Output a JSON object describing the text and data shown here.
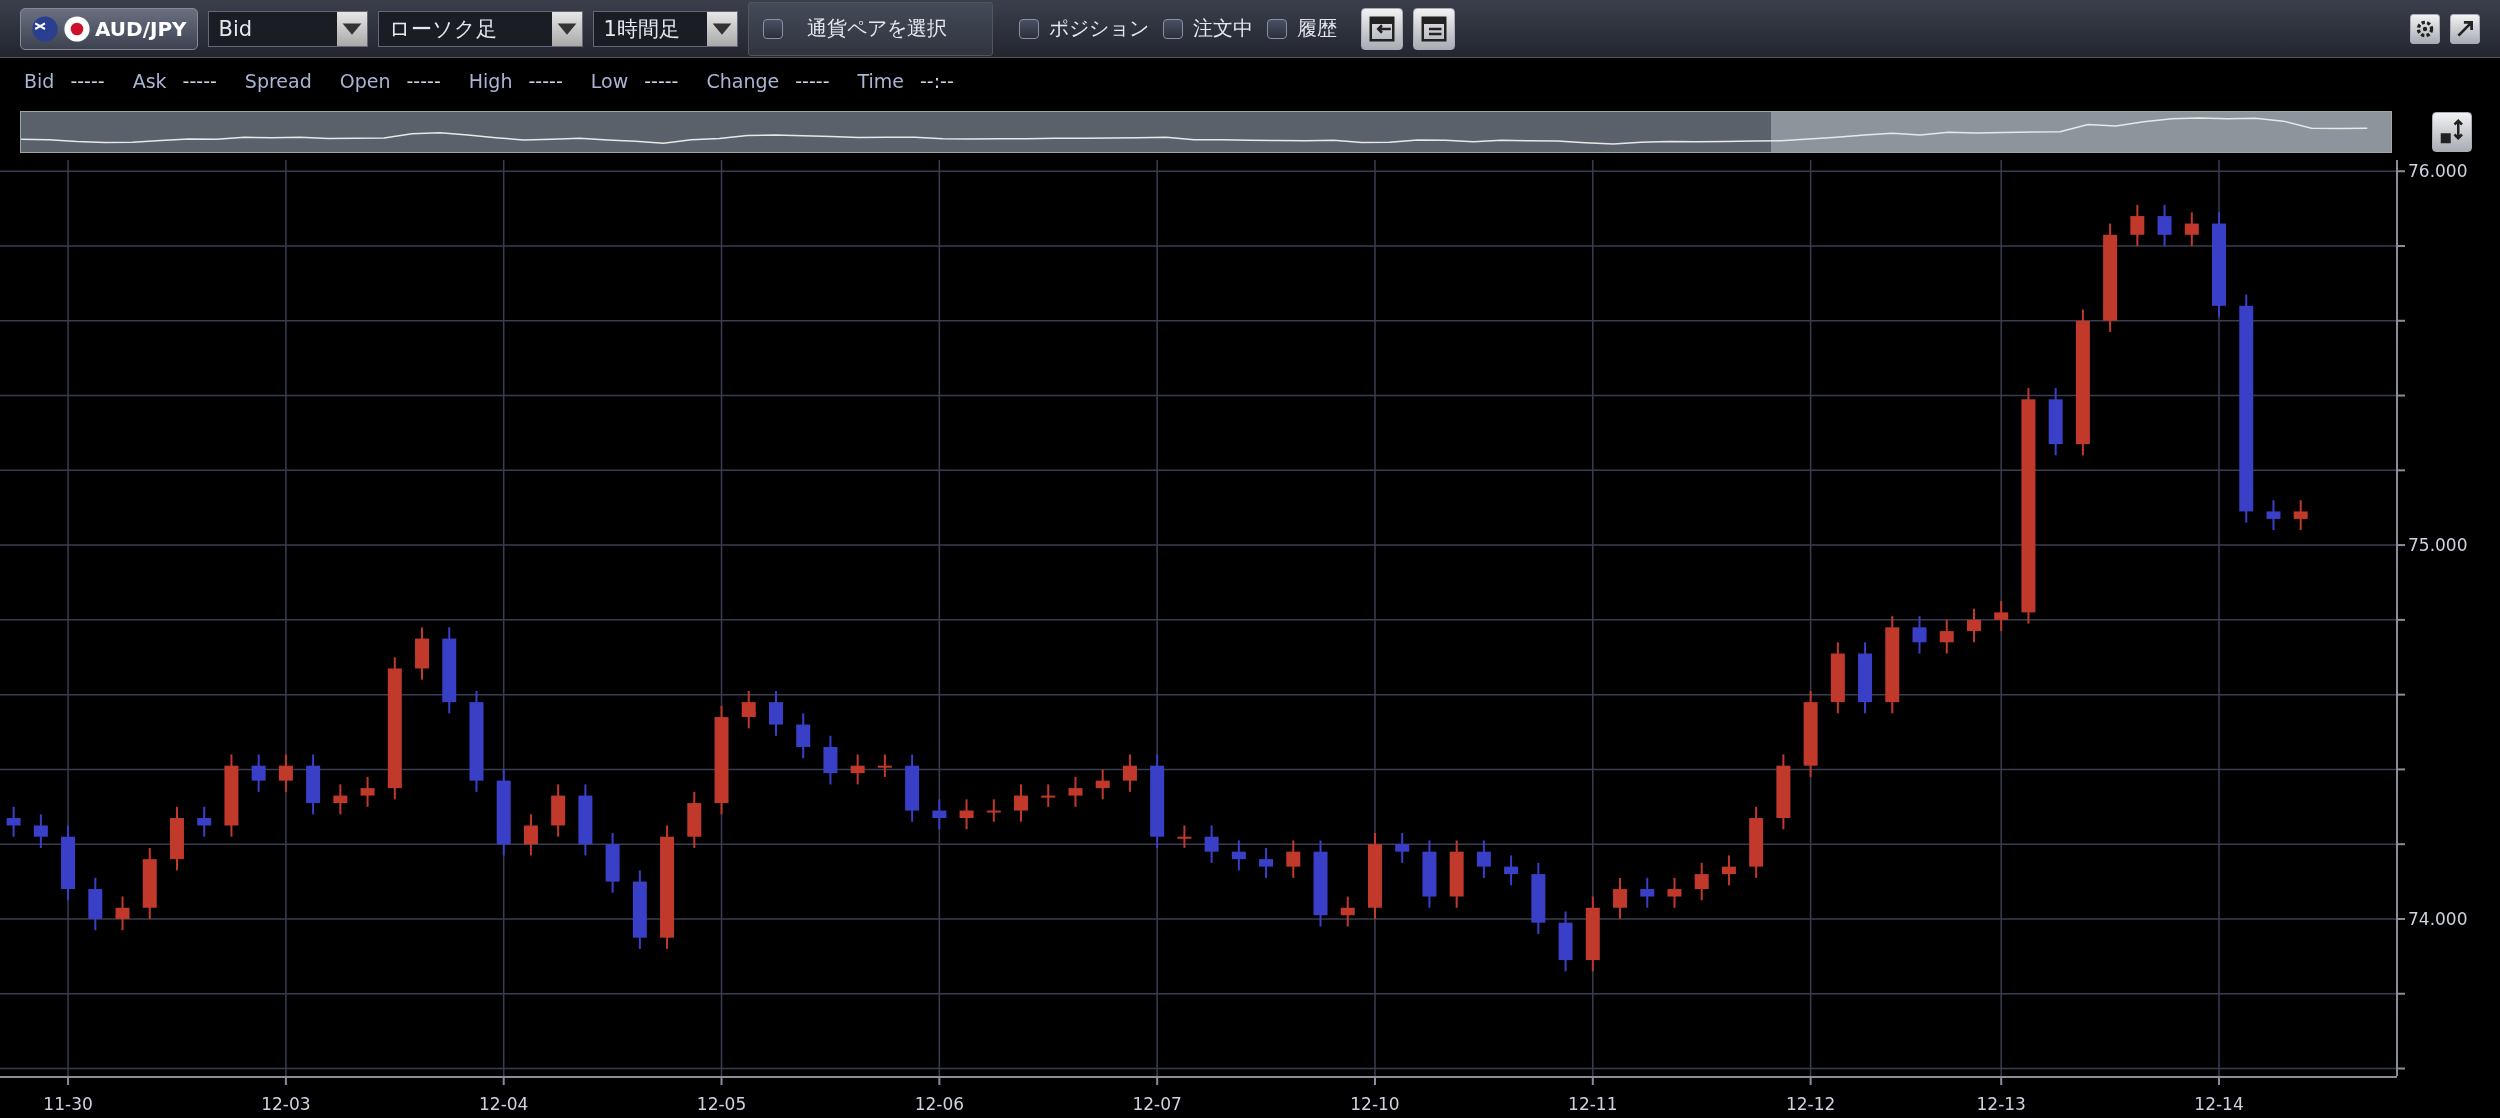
{
  "toolbar": {
    "pair": "AUD/JPY",
    "selects": [
      {
        "value": "Bid"
      },
      {
        "value": "ローソク足"
      },
      {
        "value": "1時間足"
      }
    ],
    "pair_picker": {
      "label": "通貨ペアを選択",
      "checked": false
    },
    "toggles": [
      {
        "label": "ポジション",
        "checked": false
      },
      {
        "label": "注文中",
        "checked": false
      },
      {
        "label": "履歴",
        "checked": false
      }
    ]
  },
  "info": [
    {
      "label": "Bid",
      "value": "-----"
    },
    {
      "label": "Ask",
      "value": "-----"
    },
    {
      "label": "Spread"
    },
    {
      "label": "Open",
      "value": "-----"
    },
    {
      "label": "High",
      "value": "-----"
    },
    {
      "label": "Low",
      "value": "-----"
    },
    {
      "label": "Change",
      "value": "-----"
    },
    {
      "label": "Time",
      "value": "--:--"
    }
  ],
  "chart_data": {
    "type": "candlestick",
    "grid": true,
    "ylim": [
      73.58,
      76.03
    ],
    "yticks": [
      {
        "value": 74,
        "label": "74.000"
      },
      {
        "value": 75,
        "label": "75.000"
      },
      {
        "value": 76,
        "label": "76.000"
      }
    ],
    "categories": [
      null,
      null,
      "11-30",
      null,
      null,
      null,
      null,
      null,
      null,
      null,
      "12-03",
      null,
      null,
      null,
      null,
      null,
      null,
      null,
      "12-04",
      null,
      null,
      null,
      null,
      null,
      null,
      null,
      "12-05",
      null,
      null,
      null,
      null,
      null,
      null,
      null,
      "12-06",
      null,
      null,
      null,
      null,
      null,
      null,
      null,
      "12-07",
      null,
      null,
      null,
      null,
      null,
      null,
      null,
      "12-10",
      null,
      null,
      null,
      null,
      null,
      null,
      null,
      "12-11",
      null,
      null,
      null,
      null,
      null,
      null,
      null,
      "12-12",
      null,
      null,
      null,
      null,
      null,
      null,
      "12-13",
      null,
      null,
      null,
      null,
      null,
      null,
      null,
      "12-14",
      null,
      null,
      null
    ],
    "ohlc": [
      [
        74.27,
        74.3,
        74.22,
        74.25
      ],
      [
        74.25,
        74.28,
        74.19,
        74.22
      ],
      [
        74.22,
        74.25,
        74.05,
        74.08
      ],
      [
        74.08,
        74.11,
        73.97,
        74.0
      ],
      [
        74.0,
        74.06,
        73.97,
        74.03
      ],
      [
        74.03,
        74.19,
        74.0,
        74.16
      ],
      [
        74.16,
        74.3,
        74.13,
        74.27
      ],
      [
        74.27,
        74.3,
        74.22,
        74.25
      ],
      [
        74.25,
        74.44,
        74.22,
        74.41
      ],
      [
        74.41,
        74.44,
        74.34,
        74.37
      ],
      [
        74.37,
        74.44,
        74.34,
        74.41
      ],
      [
        74.41,
        74.44,
        74.28,
        74.31
      ],
      [
        74.31,
        74.36,
        74.28,
        74.33
      ],
      [
        74.33,
        74.38,
        74.3,
        74.35
      ],
      [
        74.35,
        74.7,
        74.32,
        74.67
      ],
      [
        74.67,
        74.78,
        74.64,
        74.75
      ],
      [
        74.75,
        74.78,
        74.55,
        74.58
      ],
      [
        74.58,
        74.61,
        74.34,
        74.37
      ],
      [
        74.37,
        74.4,
        74.17,
        74.2
      ],
      [
        74.2,
        74.28,
        74.17,
        74.25
      ],
      [
        74.25,
        74.36,
        74.22,
        74.33
      ],
      [
        74.33,
        74.36,
        74.17,
        74.2
      ],
      [
        74.2,
        74.23,
        74.07,
        74.1
      ],
      [
        74.1,
        74.13,
        73.92,
        73.95
      ],
      [
        73.95,
        74.25,
        73.92,
        74.22
      ],
      [
        74.22,
        74.34,
        74.19,
        74.31
      ],
      [
        74.31,
        74.57,
        74.28,
        74.54
      ],
      [
        74.54,
        74.61,
        74.51,
        74.58
      ],
      [
        74.58,
        74.61,
        74.49,
        74.52
      ],
      [
        74.52,
        74.55,
        74.43,
        74.46
      ],
      [
        74.46,
        74.49,
        74.36,
        74.39
      ],
      [
        74.39,
        74.44,
        74.36,
        74.41
      ],
      [
        74.41,
        74.44,
        74.38,
        74.41
      ],
      [
        74.41,
        74.44,
        74.26,
        74.29
      ],
      [
        74.29,
        74.32,
        74.24,
        74.27
      ],
      [
        74.27,
        74.32,
        74.24,
        74.29
      ],
      [
        74.29,
        74.32,
        74.26,
        74.29
      ],
      [
        74.29,
        74.36,
        74.26,
        74.33
      ],
      [
        74.33,
        74.36,
        74.3,
        74.33
      ],
      [
        74.33,
        74.38,
        74.3,
        74.35
      ],
      [
        74.35,
        74.4,
        74.32,
        74.37
      ],
      [
        74.37,
        74.44,
        74.34,
        74.41
      ],
      [
        74.41,
        74.44,
        74.19,
        74.22
      ],
      [
        74.22,
        74.25,
        74.19,
        74.22
      ],
      [
        74.22,
        74.25,
        74.15,
        74.18
      ],
      [
        74.18,
        74.21,
        74.13,
        74.16
      ],
      [
        74.16,
        74.19,
        74.11,
        74.14
      ],
      [
        74.14,
        74.21,
        74.11,
        74.18
      ],
      [
        74.18,
        74.21,
        73.98,
        74.01
      ],
      [
        74.01,
        74.06,
        73.98,
        74.03
      ],
      [
        74.03,
        74.23,
        74.0,
        74.2
      ],
      [
        74.2,
        74.23,
        74.15,
        74.18
      ],
      [
        74.18,
        74.21,
        74.03,
        74.06
      ],
      [
        74.06,
        74.21,
        74.03,
        74.18
      ],
      [
        74.18,
        74.21,
        74.11,
        74.14
      ],
      [
        74.14,
        74.17,
        74.09,
        74.12
      ],
      [
        74.12,
        74.15,
        73.96,
        73.99
      ],
      [
        73.99,
        74.02,
        73.86,
        73.89
      ],
      [
        73.89,
        74.06,
        73.86,
        74.03
      ],
      [
        74.03,
        74.11,
        74.0,
        74.08
      ],
      [
        74.08,
        74.11,
        74.03,
        74.06
      ],
      [
        74.06,
        74.11,
        74.03,
        74.08
      ],
      [
        74.08,
        74.15,
        74.05,
        74.12
      ],
      [
        74.12,
        74.17,
        74.09,
        74.14
      ],
      [
        74.14,
        74.3,
        74.11,
        74.27
      ],
      [
        74.27,
        74.44,
        74.24,
        74.41
      ],
      [
        74.41,
        74.61,
        74.38,
        74.58
      ],
      [
        74.58,
        74.74,
        74.55,
        74.71
      ],
      [
        74.71,
        74.74,
        74.55,
        74.58
      ],
      [
        74.58,
        74.81,
        74.55,
        74.78
      ],
      [
        74.78,
        74.81,
        74.71,
        74.74
      ],
      [
        74.74,
        74.8,
        74.71,
        74.77
      ],
      [
        74.77,
        74.83,
        74.74,
        74.8
      ],
      [
        74.8,
        74.85,
        74.77,
        74.82
      ],
      [
        74.82,
        75.42,
        74.79,
        75.39
      ],
      [
        75.39,
        75.42,
        75.24,
        75.27
      ],
      [
        75.27,
        75.63,
        75.24,
        75.6
      ],
      [
        75.6,
        75.86,
        75.57,
        75.83
      ],
      [
        75.83,
        75.91,
        75.8,
        75.88
      ],
      [
        75.88,
        75.91,
        75.8,
        75.83
      ],
      [
        75.83,
        75.89,
        75.8,
        75.86
      ],
      [
        75.86,
        75.89,
        75.61,
        75.64
      ],
      [
        75.64,
        75.67,
        75.06,
        75.09
      ],
      [
        75.09,
        75.12,
        75.04,
        75.07
      ],
      [
        75.07,
        75.12,
        75.04,
        75.09
      ]
    ]
  }
}
